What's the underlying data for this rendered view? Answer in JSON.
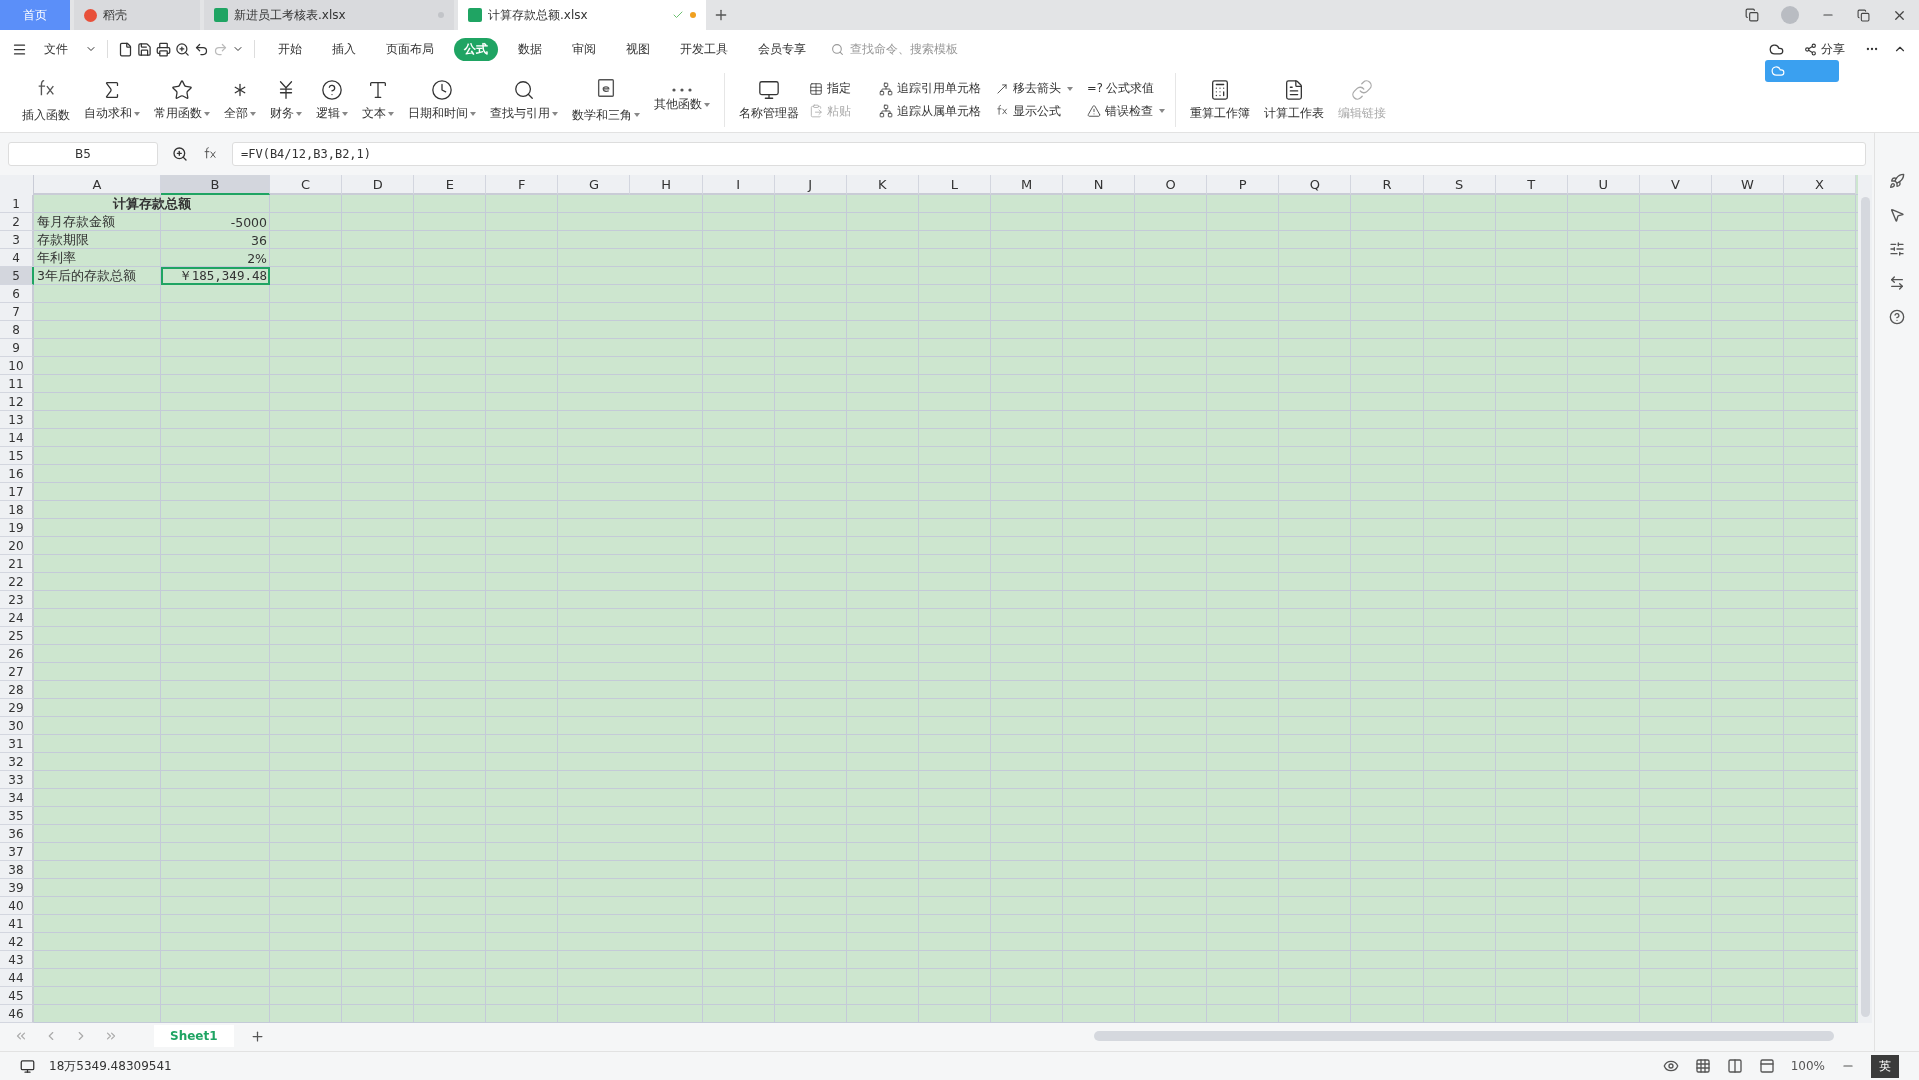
{
  "tabs": [
    {
      "label": "首页",
      "kind": "home",
      "selected": false
    },
    {
      "label": "稻壳",
      "kind": "docer",
      "selected": false
    },
    {
      "label": "新进员工考核表.xlsx",
      "kind": "sheet",
      "selected": false
    },
    {
      "label": "计算存款总额.xlsx",
      "kind": "sheet",
      "selected": true
    }
  ],
  "menu": {
    "file": "文件",
    "items": [
      {
        "label": "开始",
        "selected": false
      },
      {
        "label": "插入",
        "selected": false
      },
      {
        "label": "页面布局",
        "selected": false
      },
      {
        "label": "公式",
        "selected": true
      },
      {
        "label": "数据",
        "selected": false
      },
      {
        "label": "审阅",
        "selected": false
      },
      {
        "label": "视图",
        "selected": false
      },
      {
        "label": "开发工具",
        "selected": false
      },
      {
        "label": "会员专享",
        "selected": false
      }
    ],
    "search_placeholder": "查找命令、搜索模板",
    "share": "分享"
  },
  "ribbon": {
    "functions": [
      {
        "label": "插入函数",
        "dropdown": false
      },
      {
        "label": "自动求和",
        "dropdown": true
      },
      {
        "label": "常用函数",
        "dropdown": true
      },
      {
        "label": "全部",
        "dropdown": true
      },
      {
        "label": "财务",
        "dropdown": true
      },
      {
        "label": "逻辑",
        "dropdown": true
      },
      {
        "label": "文本",
        "dropdown": true
      },
      {
        "label": "日期和时间",
        "dropdown": true
      },
      {
        "label": "查找与引用",
        "dropdown": true
      },
      {
        "label": "数学和三角",
        "dropdown": true
      },
      {
        "label": "其他函数",
        "dropdown": true
      }
    ],
    "name_manager": "名称管理器",
    "small": [
      {
        "label": "指定",
        "dropdown": false,
        "disabled": false
      },
      {
        "label": "粘贴",
        "dropdown": false,
        "disabled": true
      },
      {
        "label": "追踪引用单元格",
        "dropdown": false,
        "disabled": false
      },
      {
        "label": "追踪从属单元格",
        "dropdown": false,
        "disabled": false
      },
      {
        "label": "移去箭头",
        "dropdown": true,
        "disabled": false
      },
      {
        "label": "显示公式",
        "dropdown": false,
        "disabled": false
      },
      {
        "label": "=? 公式求值",
        "dropdown": false,
        "disabled": false
      },
      {
        "label": "错误检查",
        "dropdown": true,
        "disabled": false
      }
    ],
    "calc": [
      {
        "label": "重算工作簿",
        "disabled": false
      },
      {
        "label": "计算工作表",
        "disabled": false
      },
      {
        "label": "编辑链接",
        "disabled": true
      }
    ]
  },
  "formula_bar": {
    "name_box": "B5",
    "formula": "=FV(B4/12,B3,B2,1)"
  },
  "columns": [
    {
      "label": "A",
      "selected": false
    },
    {
      "label": "B",
      "selected": true
    },
    {
      "label": "C",
      "selected": false
    },
    {
      "label": "D",
      "selected": false
    },
    {
      "label": "E",
      "selected": false
    },
    {
      "label": "F",
      "selected": false
    },
    {
      "label": "G",
      "selected": false
    },
    {
      "label": "H",
      "selected": false
    },
    {
      "label": "I",
      "selected": false
    },
    {
      "label": "J",
      "selected": false
    },
    {
      "label": "K",
      "selected": false
    },
    {
      "label": "L",
      "selected": false
    },
    {
      "label": "M",
      "selected": false
    },
    {
      "label": "N",
      "selected": false
    },
    {
      "label": "O",
      "selected": false
    },
    {
      "label": "P",
      "selected": false
    },
    {
      "label": "Q",
      "selected": false
    },
    {
      "label": "R",
      "selected": false
    },
    {
      "label": "S",
      "selected": false
    },
    {
      "label": "T",
      "selected": false
    },
    {
      "label": "U",
      "selected": false
    },
    {
      "label": "V",
      "selected": false
    },
    {
      "label": "W",
      "selected": false
    },
    {
      "label": "X",
      "selected": false
    }
  ],
  "rows": [
    {
      "label": "1",
      "selected": false,
      "title": "计算存款总额"
    },
    {
      "label": "2",
      "selected": false,
      "cells": [
        "每月存款金额",
        "-5000"
      ]
    },
    {
      "label": "3",
      "selected": false,
      "cells": [
        "存款期限",
        "36"
      ]
    },
    {
      "label": "4",
      "selected": false,
      "cells": [
        "年利率",
        "2%"
      ]
    },
    {
      "label": "5",
      "selected": true,
      "cells": [
        "3年后的存款总额",
        "￥185,349.48"
      ]
    },
    {
      "label": "6",
      "selected": false
    },
    {
      "label": "7",
      "selected": false
    },
    {
      "label": "8",
      "selected": false
    },
    {
      "label": "9",
      "selected": false
    },
    {
      "label": "10",
      "selected": false
    },
    {
      "label": "11",
      "selected": false
    },
    {
      "label": "12",
      "selected": false
    },
    {
      "label": "13",
      "selected": false
    },
    {
      "label": "14",
      "selected": false
    },
    {
      "label": "15",
      "selected": false
    },
    {
      "label": "16",
      "selected": false
    },
    {
      "label": "17",
      "selected": false
    },
    {
      "label": "18",
      "selected": false
    },
    {
      "label": "19",
      "selected": false
    },
    {
      "label": "20",
      "selected": false
    },
    {
      "label": "21",
      "selected": false
    },
    {
      "label": "22",
      "selected": false
    },
    {
      "label": "23",
      "selected": false
    },
    {
      "label": "24",
      "selected": false
    },
    {
      "label": "25",
      "selected": false
    },
    {
      "label": "26",
      "selected": false
    },
    {
      "label": "27",
      "selected": false
    },
    {
      "label": "28",
      "selected": false
    },
    {
      "label": "29",
      "selected": false
    },
    {
      "label": "30",
      "selected": false
    },
    {
      "label": "31",
      "selected": false
    },
    {
      "label": "32",
      "selected": false
    },
    {
      "label": "33",
      "selected": false
    },
    {
      "label": "34",
      "selected": false
    },
    {
      "label": "35",
      "selected": false
    },
    {
      "label": "36",
      "selected": false
    },
    {
      "label": "37",
      "selected": false
    },
    {
      "label": "38",
      "selected": false
    },
    {
      "label": "39",
      "selected": false
    },
    {
      "label": "40",
      "selected": false
    },
    {
      "label": "41",
      "selected": false
    },
    {
      "label": "42",
      "selected": false
    },
    {
      "label": "43",
      "selected": false
    },
    {
      "label": "44",
      "selected": false
    },
    {
      "label": "45",
      "selected": false
    },
    {
      "label": "46",
      "selected": false
    }
  ],
  "sheets": [
    {
      "label": "Sheet1",
      "selected": true
    }
  ],
  "status": {
    "value": "18万5349.48309541",
    "zoom": "100%",
    "ime": "英"
  }
}
